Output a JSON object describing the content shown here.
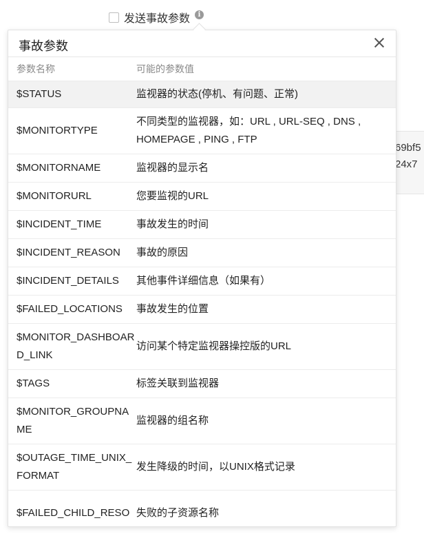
{
  "header": {
    "checkbox_label": "发送事故参数",
    "info_icon": "i"
  },
  "background_text": {
    "line1": "69bf5",
    "line2": "24x7"
  },
  "popover": {
    "title": "事故参数",
    "close_icon": "close",
    "col_name": "参数名称",
    "col_value": "可能的参数值",
    "rows": [
      {
        "name": "$STATUS",
        "value": "监视器的状态(停机、有问题、正常)"
      },
      {
        "name": "$MONITORTYPE",
        "value": "不同类型的监视器，如：URL , URL-SEQ , DNS , HOMEPAGE , PING , FTP"
      },
      {
        "name": "$MONITORNAME",
        "value": "监视器的显示名"
      },
      {
        "name": "$MONITORURL",
        "value": "您要监视的URL"
      },
      {
        "name": "$INCIDENT_TIME",
        "value": "事故发生的时间"
      },
      {
        "name": "$INCIDENT_REASON",
        "value": "事故的原因"
      },
      {
        "name": "$INCIDENT_DETAILS",
        "value": "其他事件详细信息（如果有）"
      },
      {
        "name": "$FAILED_LOCATIONS",
        "value": "事故发生的位置"
      },
      {
        "name": "$MONITOR_DASHBOARD_LINK",
        "value": "访问某个特定监视器操控版的URL"
      },
      {
        "name": "$TAGS",
        "value": "标签关联到监视器"
      },
      {
        "name": "$MONITOR_GROUPNAME",
        "value": "监视器的组名称"
      },
      {
        "name": "$OUTAGE_TIME_UNIX_FORMAT",
        "value": "发生降级的时间，以UNIX格式记录"
      },
      {
        "name": "$FAILED_CHILD_RESO",
        "value": "失败的子资源名称"
      }
    ]
  }
}
